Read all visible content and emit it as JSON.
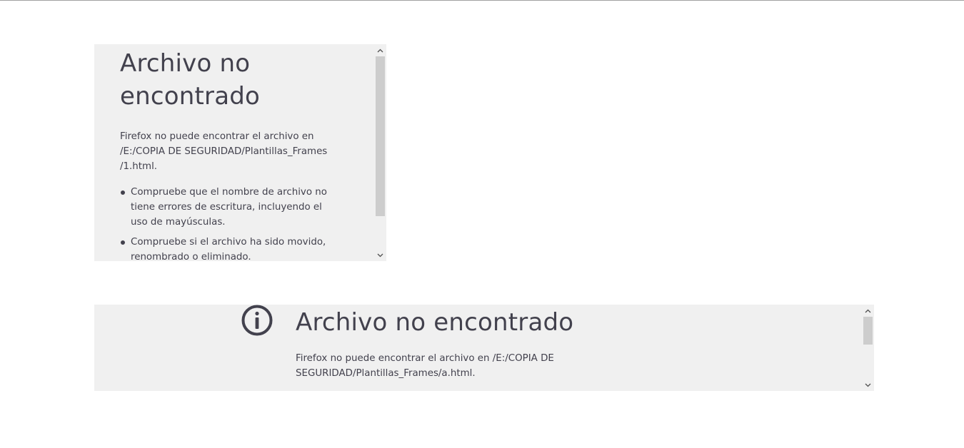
{
  "frames": [
    {
      "title": "Archivo no encontrado",
      "description": "Firefox no puede encontrar el archivo en /E:/COPIA DE SEGURIDAD/Plantillas_Frames /1.html.",
      "suggestions": [
        "Compruebe que el nombre de archivo no tiene errores de escritura, incluyendo el uso de mayúsculas.",
        "Compruebe si el archivo ha sido movido, renombrado o eliminado."
      ]
    },
    {
      "icon": "info-icon",
      "title": "Archivo no encontrado",
      "description": "Firefox no puede encontrar el archivo en /E:/COPIA DE SEGURIDAD/Plantillas_Frames/a.html."
    }
  ],
  "colors": {
    "frame_bg": "#f0f0f0",
    "text": "#42414d",
    "scroll_thumb": "#cdcdcd"
  }
}
